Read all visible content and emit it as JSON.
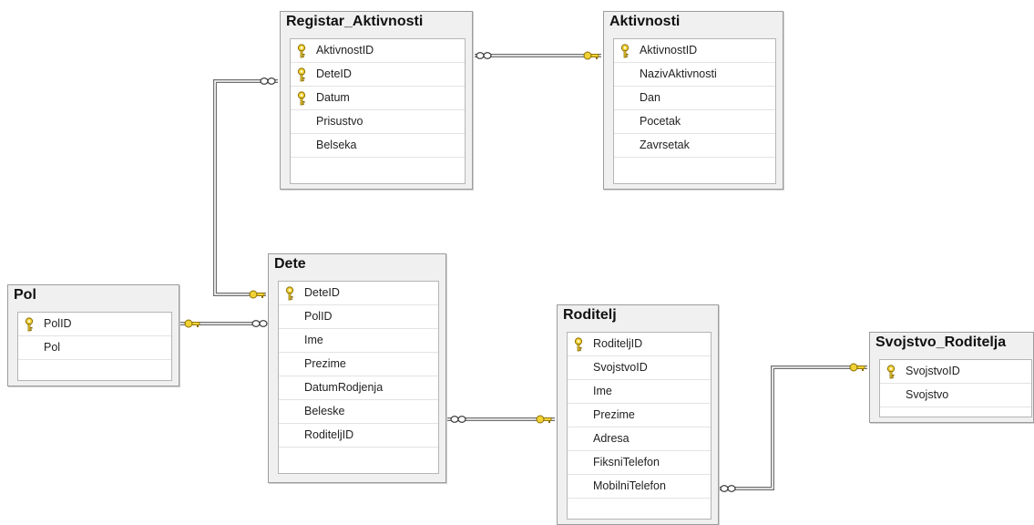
{
  "tables": {
    "registar_aktivnosti": {
      "title": "Registar_Aktivnosti",
      "columns": [
        {
          "name": "AktivnostID",
          "pk": true
        },
        {
          "name": "DeteID",
          "pk": true
        },
        {
          "name": "Datum",
          "pk": true
        },
        {
          "name": "Prisustvo",
          "pk": false
        },
        {
          "name": "Belseka",
          "pk": false
        }
      ]
    },
    "aktivnosti": {
      "title": "Aktivnosti",
      "columns": [
        {
          "name": "AktivnostID",
          "pk": true
        },
        {
          "name": "NazivAktivnosti",
          "pk": false
        },
        {
          "name": "Dan",
          "pk": false
        },
        {
          "name": "Pocetak",
          "pk": false
        },
        {
          "name": "Zavrsetak",
          "pk": false
        }
      ]
    },
    "dete": {
      "title": "Dete",
      "columns": [
        {
          "name": "DeteID",
          "pk": true
        },
        {
          "name": "PolID",
          "pk": false
        },
        {
          "name": "Ime",
          "pk": false
        },
        {
          "name": "Prezime",
          "pk": false
        },
        {
          "name": "DatumRodjenja",
          "pk": false
        },
        {
          "name": "Beleske",
          "pk": false
        },
        {
          "name": "RoditeljID",
          "pk": false
        }
      ]
    },
    "pol": {
      "title": "Pol",
      "columns": [
        {
          "name": "PolID",
          "pk": true
        },
        {
          "name": "Pol",
          "pk": false
        }
      ]
    },
    "roditelj": {
      "title": "Roditelj",
      "columns": [
        {
          "name": "RoditeljID",
          "pk": true
        },
        {
          "name": "SvojstvoID",
          "pk": false
        },
        {
          "name": "Ime",
          "pk": false
        },
        {
          "name": "Prezime",
          "pk": false
        },
        {
          "name": "Adresa",
          "pk": false
        },
        {
          "name": "FiksniTelefon",
          "pk": false
        },
        {
          "name": "MobilniTelefon",
          "pk": false
        }
      ]
    },
    "svojstvo_roditelja": {
      "title": "Svojstvo_Roditelja",
      "columns": [
        {
          "name": "SvojstvoID",
          "pk": true
        },
        {
          "name": "Svojstvo",
          "pk": false
        }
      ]
    }
  },
  "colors": {
    "key_fill": "#f1d235",
    "key_stroke": "#8a6d00",
    "line": "#6e6e6e"
  },
  "icons": {
    "primary_key": "key-icon",
    "many_end": "infinity-icon",
    "one_end": "key-icon"
  }
}
